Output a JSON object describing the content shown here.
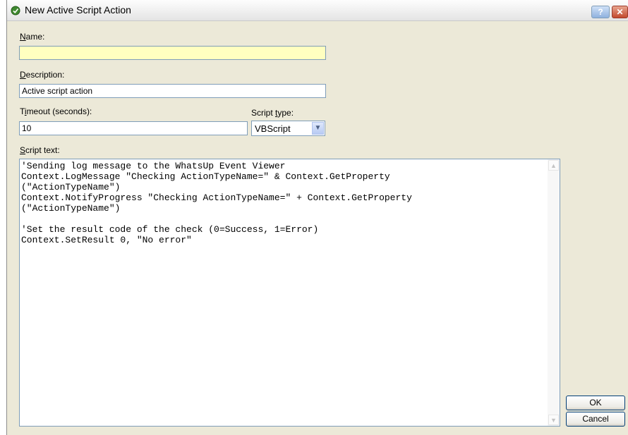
{
  "window": {
    "title": "New Active Script Action",
    "help_label": "?",
    "close_label": "✕"
  },
  "form": {
    "name": {
      "label_mnemonic": "N",
      "label_rest": "ame:",
      "value": ""
    },
    "description": {
      "label_mnemonic": "D",
      "label_rest": "escription:",
      "value": "Active script action"
    },
    "timeout": {
      "label_pre": "T",
      "label_mnemonic": "i",
      "label_rest": "meout (seconds):",
      "value": "10"
    },
    "script_type": {
      "label_pre": "Script ",
      "label_mnemonic": "t",
      "label_rest": "ype:",
      "value": "VBScript"
    },
    "script_text": {
      "label_mnemonic": "S",
      "label_rest": "cript text:",
      "value": "'Sending log message to the WhatsUp Event Viewer\nContext.LogMessage \"Checking ActionTypeName=\" & Context.GetProperty\n(\"ActionTypeName\")\nContext.NotifyProgress \"Checking ActionTypeName=\" + Context.GetProperty\n(\"ActionTypeName\")\n\n'Set the result code of the check (0=Success, 1=Error)\nContext.SetResult 0, \"No error\""
    }
  },
  "buttons": {
    "ok": "OK",
    "cancel": "Cancel"
  },
  "colors": {
    "dialog_bg": "#ece9d8",
    "name_field_bg": "#ffffc0",
    "border": "#7f9db9"
  }
}
